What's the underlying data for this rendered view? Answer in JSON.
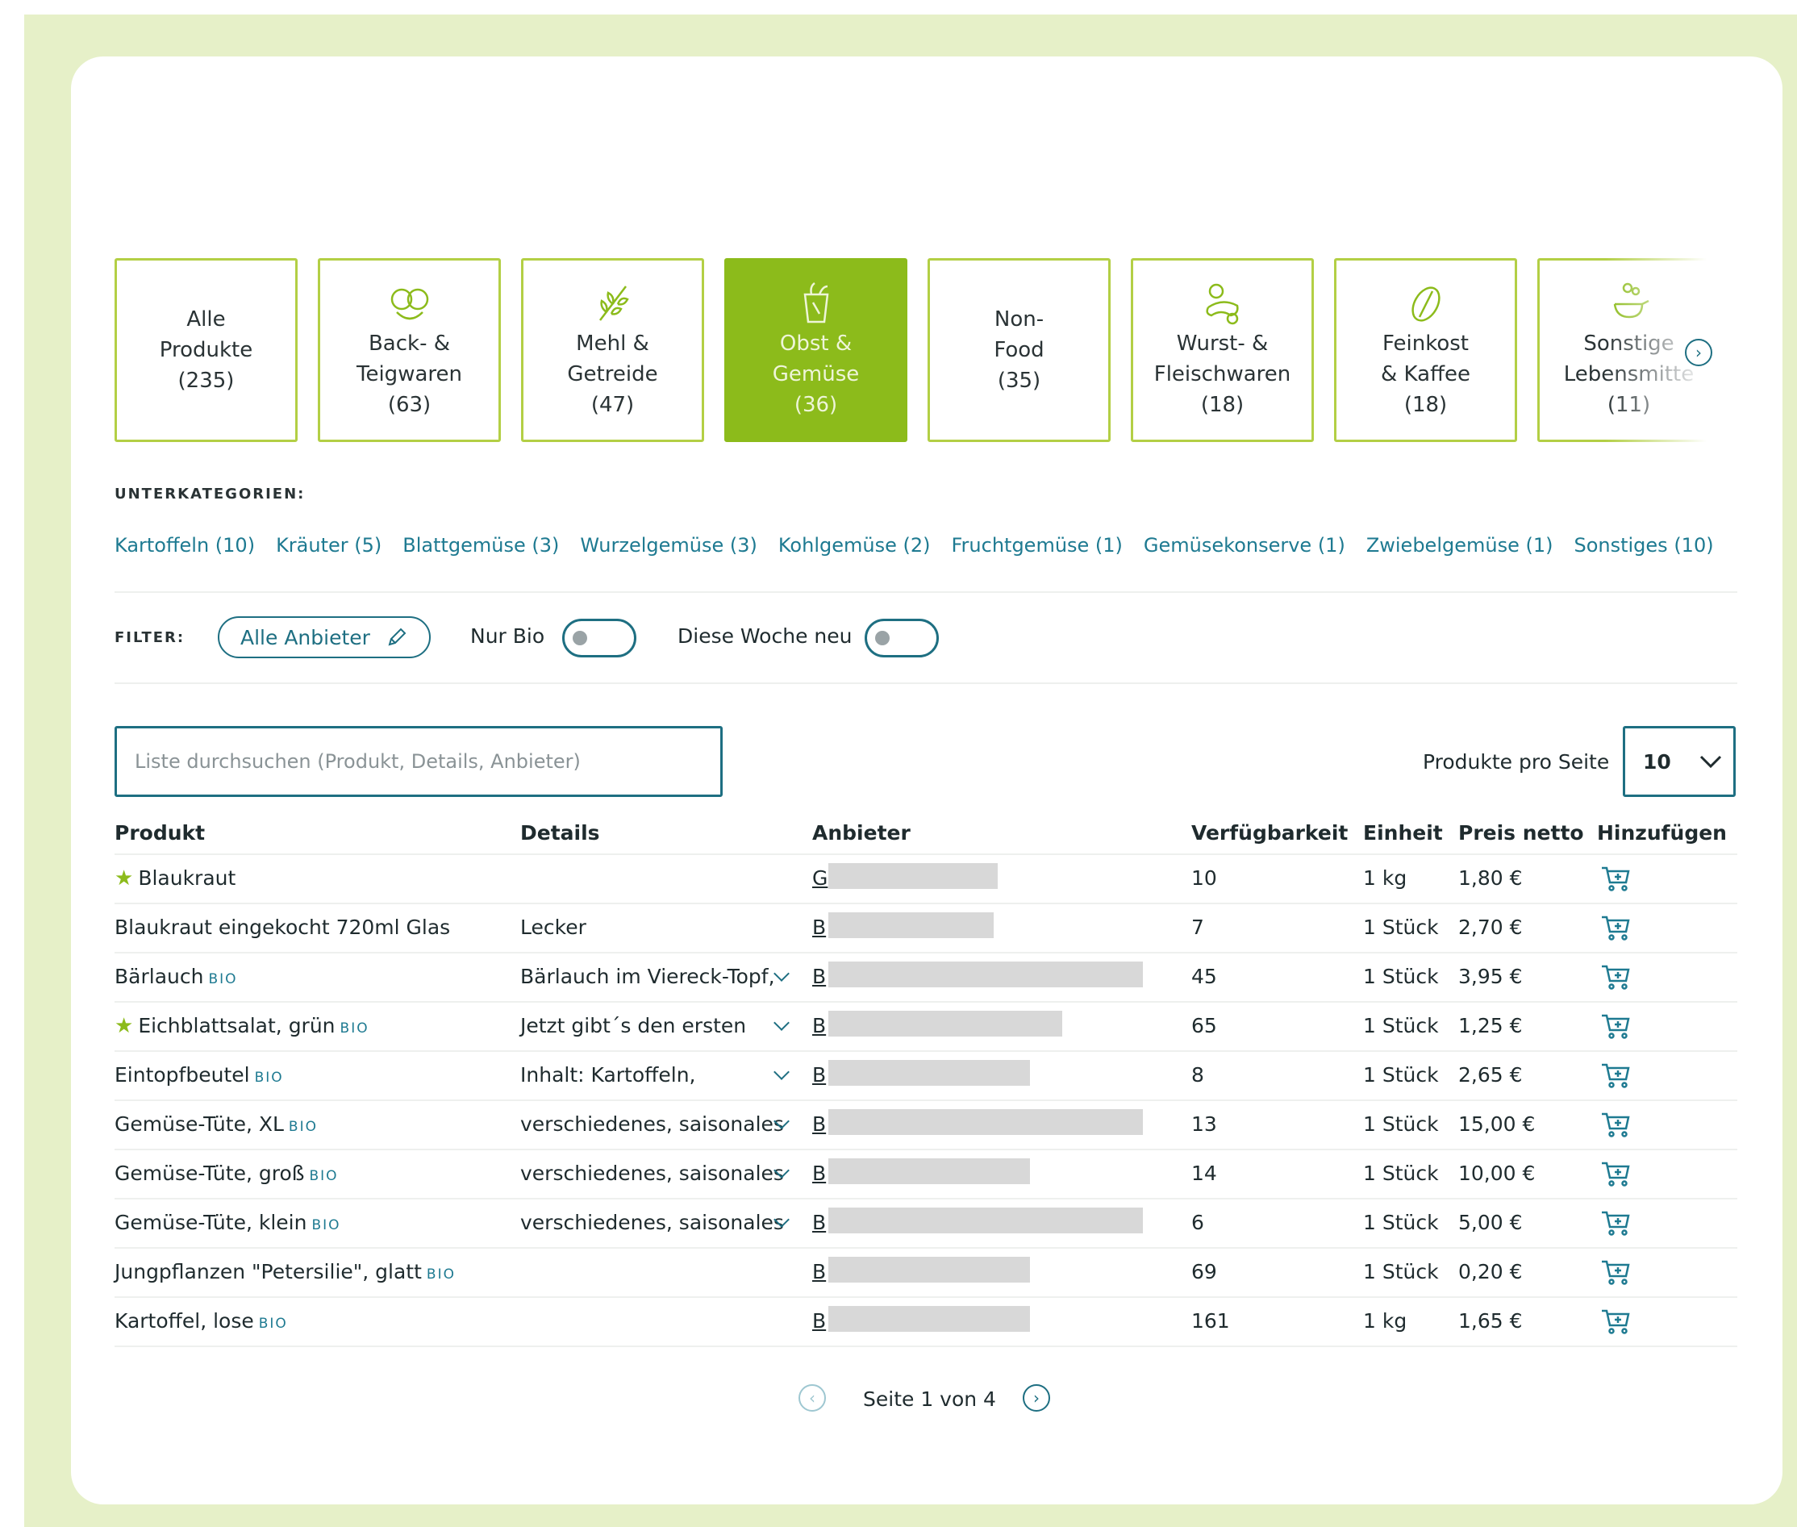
{
  "categories": [
    {
      "lines": [
        "Alle",
        "Produkte",
        "(235)"
      ],
      "icon": "none",
      "active": false
    },
    {
      "lines": [
        "Back- &",
        "Teigwaren",
        "(63)"
      ],
      "icon": "pretzel-icon",
      "active": false
    },
    {
      "lines": [
        "Mehl &",
        "Getreide",
        "(47)"
      ],
      "icon": "grain-icon",
      "active": false
    },
    {
      "lines": [
        "Obst &",
        "Gemüse",
        "(36)"
      ],
      "icon": "vegetable-icon",
      "active": true
    },
    {
      "lines": [
        "Non-",
        "Food",
        "(35)"
      ],
      "icon": "none",
      "active": false
    },
    {
      "lines": [
        "Wurst- &",
        "Fleischwaren",
        "(18)"
      ],
      "icon": "sausage-icon",
      "active": false
    },
    {
      "lines": [
        "Feinkost",
        "& Kaffee",
        "(18)"
      ],
      "icon": "coffee-bean-icon",
      "active": false
    },
    {
      "lines": [
        "Sonstige",
        "Lebensmitte",
        "(11)"
      ],
      "icon": "cooking-icon",
      "active": false
    }
  ],
  "subcategories_label": "UNTERKATEGORIEN:",
  "subcategories": [
    "Kartoffeln (10)",
    "Kräuter (5)",
    "Blattgemüse (3)",
    "Wurzelgemüse (3)",
    "Kohlgemüse (2)",
    "Fruchtgemüse (1)",
    "Gemüsekonserve (1)",
    "Zwiebelgemüse (1)",
    "Sonstiges (10)"
  ],
  "filter": {
    "label": "FILTER:",
    "provider_pill": "Alle Anbieter",
    "nur_bio_label": "Nur Bio",
    "nur_bio_on": false,
    "neu_label": "Diese Woche neu",
    "neu_on": false
  },
  "search": {
    "placeholder": "Liste durchsuchen (Produkt, Details, Anbieter)",
    "value": ""
  },
  "per_page": {
    "label": "Produkte pro Seite",
    "value": "10"
  },
  "table": {
    "headers": {
      "produkt": "Produkt",
      "details": "Details",
      "anbieter": "Anbieter",
      "verfuegbarkeit": "Verfügbarkeit",
      "einheit": "Einheit",
      "preis": "Preis netto",
      "hinzufuegen": "Hinzufügen"
    },
    "bio_tag": "BIO",
    "rows": [
      {
        "produkt": "Blaukraut",
        "star": true,
        "bio": false,
        "details": "",
        "expand": false,
        "anbieter": "G",
        "redact_w": 210,
        "verf": "10",
        "einheit": "1 kg",
        "preis": "1,80 €"
      },
      {
        "produkt": "Blaukraut eingekocht 720ml Glas",
        "star": false,
        "bio": false,
        "details": "Lecker",
        "expand": false,
        "anbieter": "B",
        "redact_w": 205,
        "verf": "7",
        "einheit": "1 Stück",
        "preis": "2,70 €"
      },
      {
        "produkt": "Bärlauch",
        "star": false,
        "bio": true,
        "details": "Bärlauch im Viereck-Topf,",
        "expand": true,
        "anbieter": "B",
        "redact_w": 390,
        "verf": "45",
        "einheit": "1 Stück",
        "preis": "3,95 €"
      },
      {
        "produkt": "Eichblattsalat, grün",
        "star": true,
        "bio": true,
        "details": "Jetzt gibt´s den ersten",
        "expand": true,
        "anbieter": "B",
        "redact_w": 290,
        "verf": "65",
        "einheit": "1 Stück",
        "preis": "1,25 €"
      },
      {
        "produkt": "Eintopfbeutel",
        "star": false,
        "bio": true,
        "details": "Inhalt: Kartoffeln,",
        "expand": true,
        "anbieter": "B",
        "redact_w": 250,
        "verf": "8",
        "einheit": "1 Stück",
        "preis": "2,65 €"
      },
      {
        "produkt": "Gemüse-Tüte, XL",
        "star": false,
        "bio": true,
        "details": "verschiedenes, saisonales",
        "expand": true,
        "anbieter": "B",
        "redact_w": 390,
        "verf": "13",
        "einheit": "1 Stück",
        "preis": "15,00 €"
      },
      {
        "produkt": "Gemüse-Tüte, groß",
        "star": false,
        "bio": true,
        "details": "verschiedenes, saisonales",
        "expand": true,
        "anbieter": "B",
        "redact_w": 250,
        "verf": "14",
        "einheit": "1 Stück",
        "preis": "10,00 €"
      },
      {
        "produkt": "Gemüse-Tüte, klein",
        "star": false,
        "bio": true,
        "details": "verschiedenes, saisonales",
        "expand": true,
        "anbieter": "B",
        "redact_w": 390,
        "verf": "6",
        "einheit": "1 Stück",
        "preis": "5,00 €"
      },
      {
        "produkt": "Jungpflanzen \"Petersilie\", glatt",
        "star": false,
        "bio": true,
        "details": "",
        "expand": false,
        "anbieter": "B",
        "redact_w": 250,
        "verf": "69",
        "einheit": "1 Stück",
        "preis": "0,20 €"
      },
      {
        "produkt": "Kartoffel, lose",
        "star": false,
        "bio": true,
        "details": "",
        "expand": false,
        "anbieter": "B",
        "redact_w": 250,
        "verf": "161",
        "einheit": "1 kg",
        "preis": "1,65 €"
      }
    ]
  },
  "pagination": {
    "text": "Seite 1 von 4",
    "prev_enabled": false,
    "next_enabled": true
  },
  "colors": {
    "accent_green": "#8cbb1b",
    "teal": "#1e6f82",
    "background": "#e6f0c8"
  }
}
